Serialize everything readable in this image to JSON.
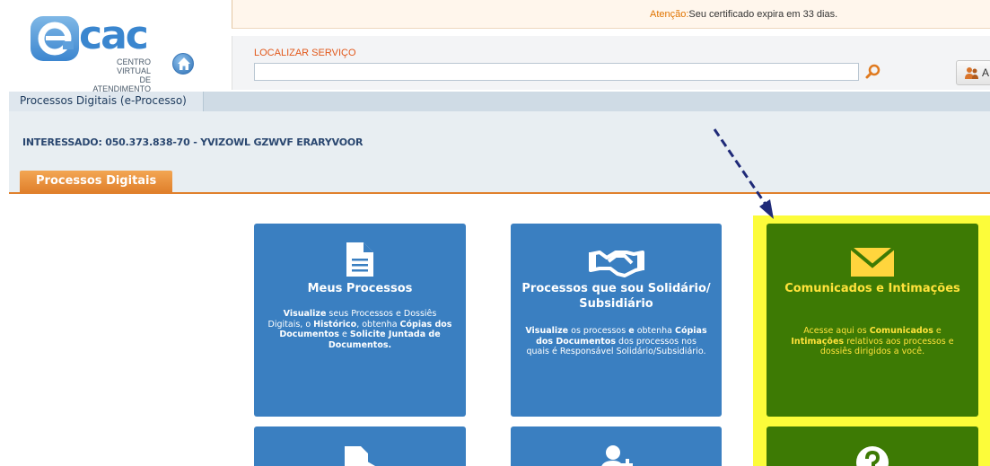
{
  "logo": {
    "brand": "cac",
    "subtitle_line1": "CENTRO VIRTUAL",
    "subtitle_line2": "DE ATENDIMENTO"
  },
  "alert": {
    "label": "Atenção:",
    "message": "Seu certificado expira em 33 dias."
  },
  "search": {
    "label": "LOCALIZAR SERVIÇO",
    "value": "",
    "placeholder": ""
  },
  "toolbar": {
    "people_button_label": "A"
  },
  "section": {
    "title": "Processos Digitais (e-Processo)"
  },
  "interessado": "INTERESSADO: 050.373.838-70 - YVIZOWL GZWVF ERARYVOOR",
  "tab": {
    "label": "Processos Digitais"
  },
  "cards": [
    {
      "title": "Meus Processos",
      "desc": [
        {
          "t": "Visualize",
          "b": true
        },
        {
          "t": " seus Processos e Dossiês Digitais, o ",
          "b": false
        },
        {
          "t": "Histórico",
          "b": true
        },
        {
          "t": ", obtenha ",
          "b": false
        },
        {
          "t": "Cópias dos Documentos",
          "b": true
        },
        {
          "t": " e ",
          "b": false
        },
        {
          "t": "Solicite Juntada de Documentos.",
          "b": true
        }
      ]
    },
    {
      "title": "Processos que sou Solidário/ Subsidiário",
      "desc": [
        {
          "t": "Visualize",
          "b": true
        },
        {
          "t": " os processos ",
          "b": false
        },
        {
          "t": "e",
          "b": true
        },
        {
          "t": " obtenha ",
          "b": false
        },
        {
          "t": "Cópias dos Documentos",
          "b": true
        },
        {
          "t": " dos processos nos quais é Responsável Solidário/Subsidiário.",
          "b": false
        }
      ]
    },
    {
      "title": "Comunicados e Intimações",
      "desc": [
        {
          "t": "Acesse aqui os ",
          "b": false
        },
        {
          "t": "Comunicados",
          "b": true
        },
        {
          "t": " e ",
          "b": false
        },
        {
          "t": "Intimações",
          "b": true
        },
        {
          "t": " relativos aos processos e dossiês dirigidos a você.",
          "b": false
        }
      ]
    }
  ],
  "colors": {
    "card_blue": "#3a7fc1",
    "card_green": "#3d7a04",
    "highlight_yellow": "#fcfc3a",
    "accent_orange": "#e0802c",
    "arrow_navy": "#1f2a78"
  },
  "icons": [
    "home-icon",
    "search-icon",
    "people-icon",
    "document-icon",
    "handshake-icon",
    "envelope-icon",
    "document-export-icon",
    "person-add-icon",
    "question-icon"
  ]
}
